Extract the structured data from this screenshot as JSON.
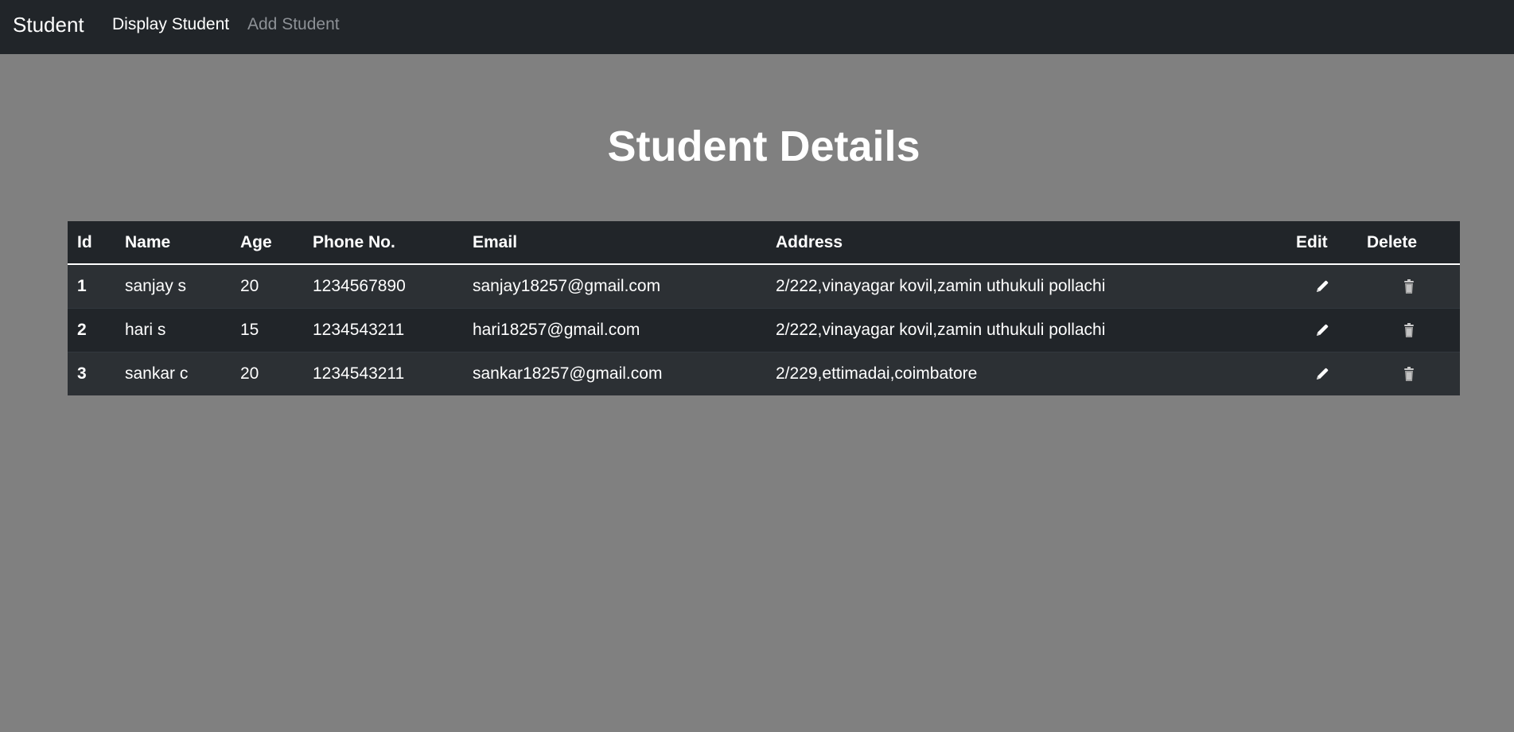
{
  "navbar": {
    "brand": "Student",
    "links": [
      {
        "label": "Display Student",
        "active": true
      },
      {
        "label": "Add Student",
        "active": false
      }
    ]
  },
  "page": {
    "title": "Student Details"
  },
  "table": {
    "headers": {
      "id": "Id",
      "name": "Name",
      "age": "Age",
      "phone": "Phone No.",
      "email": "Email",
      "address": "Address",
      "edit": "Edit",
      "delete": "Delete"
    },
    "rows": [
      {
        "id": "1",
        "name": "sanjay s",
        "age": "20",
        "phone": "1234567890",
        "email": "sanjay18257@gmail.com",
        "address": "2/222,vinayagar kovil,zamin uthukuli pollachi",
        "edit_icon": "pencil-icon",
        "delete_icon": "trash-icon"
      },
      {
        "id": "2",
        "name": "hari s",
        "age": "15",
        "phone": "1234543211",
        "email": "hari18257@gmail.com",
        "address": "2/222,vinayagar kovil,zamin uthukuli pollachi",
        "edit_icon": "pencil-icon",
        "delete_icon": "trash-icon"
      },
      {
        "id": "3",
        "name": "sankar c",
        "age": "20",
        "phone": "1234543211",
        "email": "sankar18257@gmail.com",
        "address": "2/229,ettimadai,coimbatore",
        "edit_icon": "pencil-icon",
        "delete_icon": "trash-icon"
      }
    ]
  },
  "colors": {
    "navbar_bg": "#212529",
    "page_bg": "#808080",
    "table_row_odd": "#2c3034",
    "table_row_even": "#212529",
    "muted_link": "#8d9196"
  }
}
